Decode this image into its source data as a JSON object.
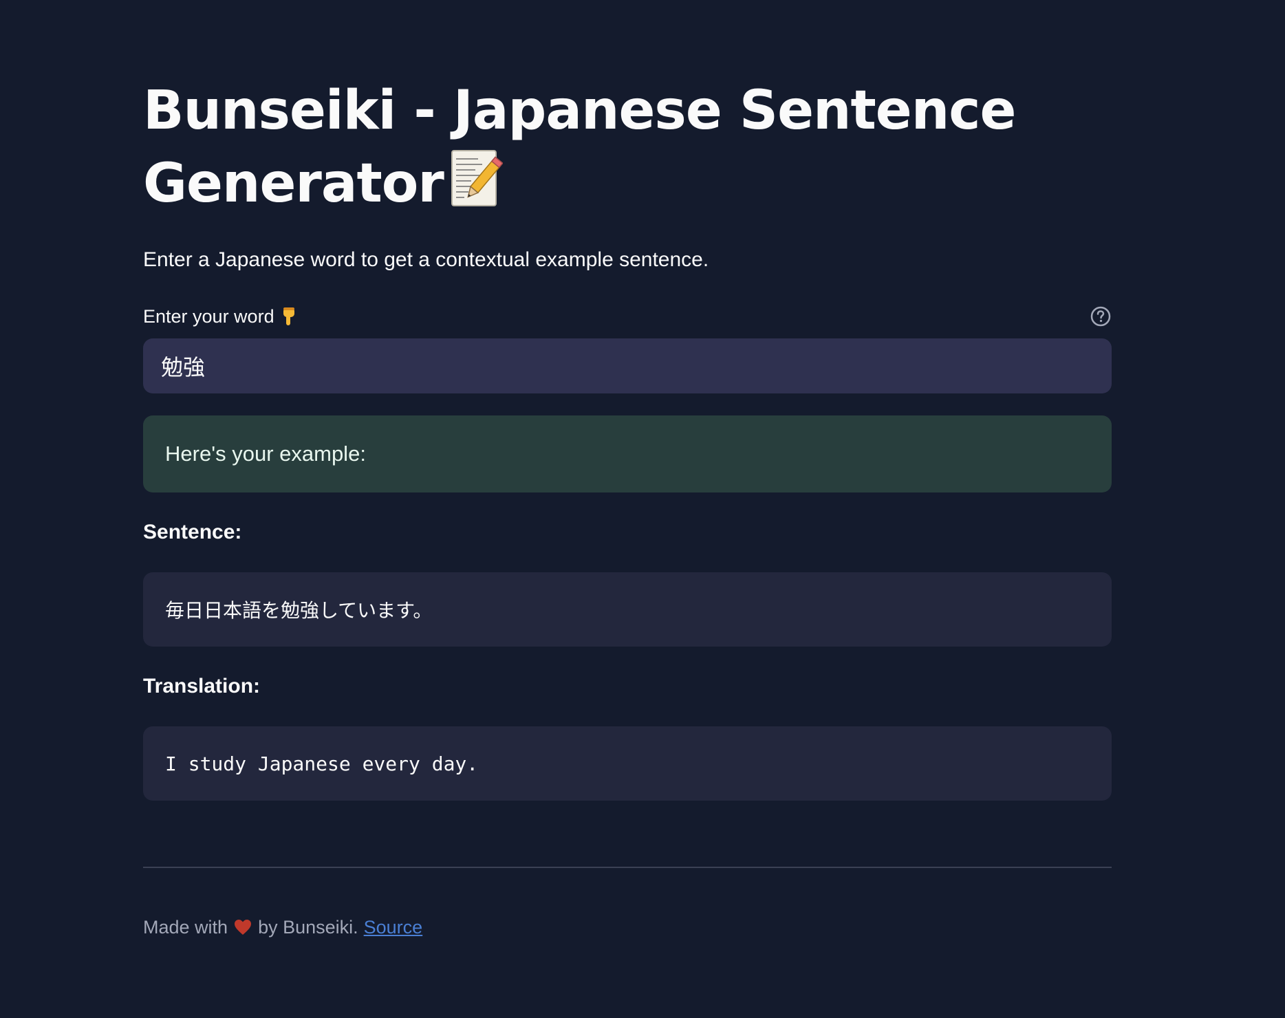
{
  "header": {
    "title": "Bunseiki - Japanese Sentence Generator",
    "title_icon": "memo-pencil-icon",
    "subtitle": "Enter a Japanese word to get a contextual example sentence."
  },
  "input": {
    "label": "Enter your word",
    "label_icon": "pointing-down-hand-icon",
    "help_icon": "question-circle-icon",
    "value": "勉強"
  },
  "result": {
    "status_message": "Here's your example:",
    "sentence_label": "Sentence:",
    "sentence": "毎日日本語を勉強しています。",
    "translation_label": "Translation:",
    "translation": "I study Japanese every day."
  },
  "footer": {
    "text_before": "Made with",
    "heart_icon": "heart-icon",
    "text_after": "by Bunseiki.",
    "link_label": "Source"
  },
  "colors": {
    "background": "#141b2d",
    "input_background": "#2f3150",
    "success_background": "#283e3d",
    "code_background": "#23273d",
    "link": "#4a7fd4"
  }
}
